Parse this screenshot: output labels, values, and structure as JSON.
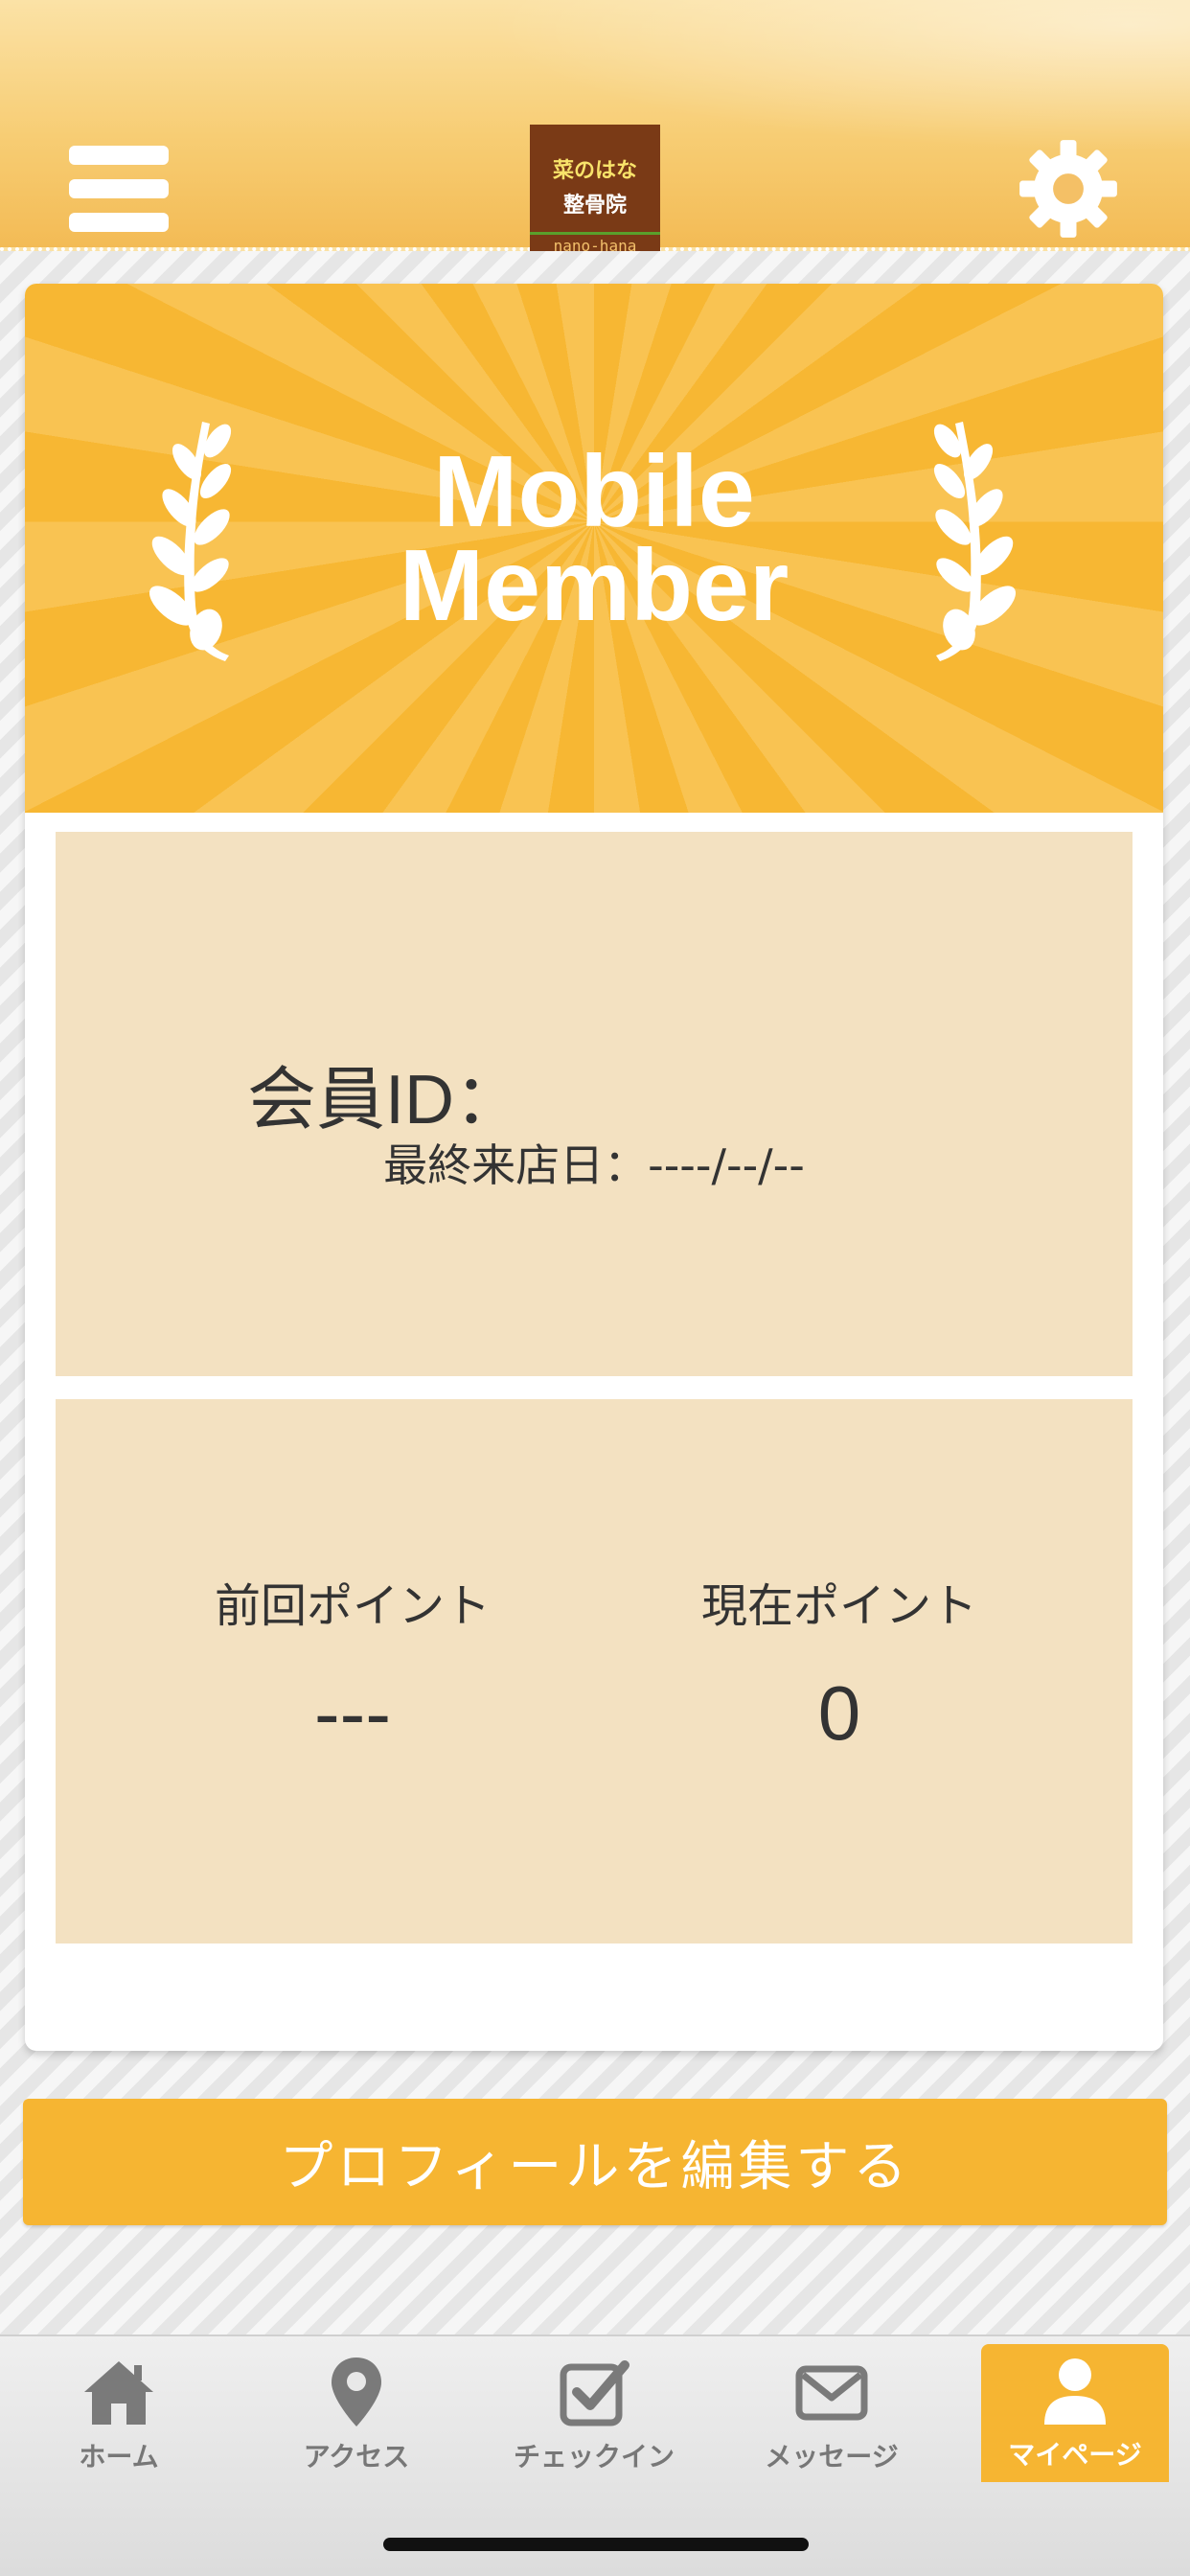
{
  "header": {
    "logo_line1": "菜のはな",
    "logo_line2": "整骨院",
    "logo_line3": "nano-hana"
  },
  "banner": {
    "title_line1": "Mobile",
    "title_line2": "Member"
  },
  "member": {
    "id_label": "会員ID：",
    "last_visit": "最終来店日：----/--/--"
  },
  "points": {
    "previous_label": "前回ポイント",
    "previous_value": "---",
    "current_label": "現在ポイント",
    "current_value": "0"
  },
  "edit_button": "プロフィールを編集する",
  "tabs": [
    {
      "label": "ホーム",
      "icon": "home-icon"
    },
    {
      "label": "アクセス",
      "icon": "map-pin-icon"
    },
    {
      "label": "チェックイン",
      "icon": "checkbox-icon"
    },
    {
      "label": "メッセージ",
      "icon": "envelope-icon"
    },
    {
      "label": "マイページ",
      "icon": "user-icon",
      "active": true
    }
  ],
  "colors": {
    "accent": "#f6b532",
    "panel": "#f3e1c1",
    "tab_inactive": "#777777"
  }
}
